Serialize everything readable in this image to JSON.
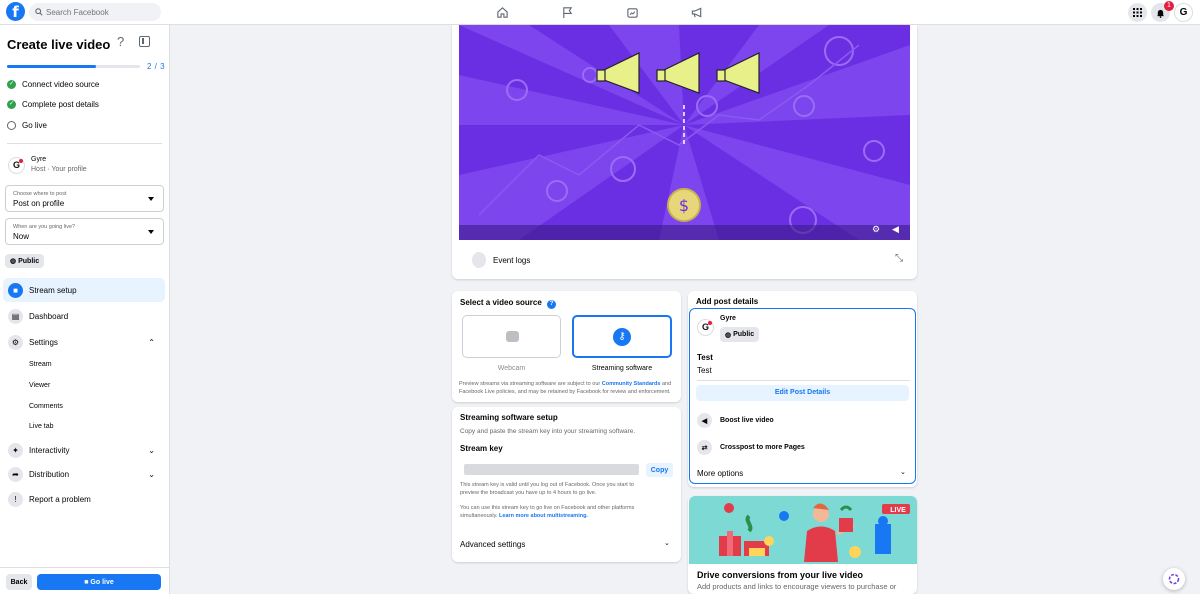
{
  "header": {
    "logo": "f",
    "search_placeholder": "Search Facebook",
    "notification_count": "1",
    "profile_initial": "G",
    "nav_icons": [
      "home-icon",
      "flag-icon",
      "gaming-icon",
      "megaphone-icon"
    ]
  },
  "sidebar": {
    "title": "Create live video",
    "help": "?",
    "progress_text": "2 / 3",
    "progress_fraction": 0.67,
    "steps": [
      {
        "label": "Connect video source",
        "done": true
      },
      {
        "label": "Complete post details",
        "done": true
      },
      {
        "label": "Go live",
        "done": false
      }
    ],
    "host_name": "Gyre",
    "host_sub": "Host · Your profile",
    "where_label": "Choose where to post",
    "where_value": "Post on profile",
    "when_label": "When are you going live?",
    "when_value": "Now",
    "audience": "Public",
    "nav": [
      {
        "label": "Stream setup",
        "icon": "camera-icon",
        "active": true
      },
      {
        "label": "Dashboard",
        "icon": "dashboard-icon"
      },
      {
        "label": "Settings",
        "icon": "gear-icon"
      }
    ],
    "settings_sub": [
      "Stream",
      "Viewer",
      "Comments",
      "Live tab"
    ],
    "nav_lower": [
      {
        "label": "Interactivity",
        "icon": "sparkle-icon"
      },
      {
        "label": "Distribution",
        "icon": "share-icon"
      },
      {
        "label": "Report a problem",
        "icon": "report-icon"
      }
    ],
    "back_label": "Back",
    "golive_label": "Go live"
  },
  "main": {
    "event_logs": "Event logs",
    "video_source": {
      "title": "Select a video source",
      "options": [
        "Webcam",
        "Streaming software"
      ],
      "selected": "Streaming software",
      "note_prefix": "Preview streams via streaming software are subject to our ",
      "note_link": "Community Standards",
      "note_mid": " and",
      "note_line2": "Facebook Live policies, and may be retained by Facebook for review and enforcement."
    },
    "software_setup": {
      "title": "Streaming software setup",
      "desc": "Copy and paste the stream key into your streaming software.",
      "key_label": "Stream key",
      "copy_label": "Copy",
      "valid_line1": "This stream key is valid until you log out of Facebook. Once you start to",
      "valid_line2": "preview the broadcast you have up to 4 hours to go live.",
      "multi_line1": "You can use this stream key to go live on Facebook and other platforms",
      "multi_prefix": "simultaneously. ",
      "multi_link": "Learn more about multistreaming.",
      "advanced": "Advanced settings"
    },
    "post_details": {
      "title": "Add post details",
      "author": "Gyre",
      "audience": "Public",
      "post_title": "Test",
      "post_body": "Test",
      "edit_label": "Edit Post Details",
      "boost": "Boost live video",
      "crosspost": "Crosspost to more Pages",
      "more_options": "More options"
    },
    "promo": {
      "title": "Drive conversions from your live video",
      "subtitle": "Add products and links to encourage viewers to purchase or",
      "live_badge": "LIVE"
    }
  }
}
